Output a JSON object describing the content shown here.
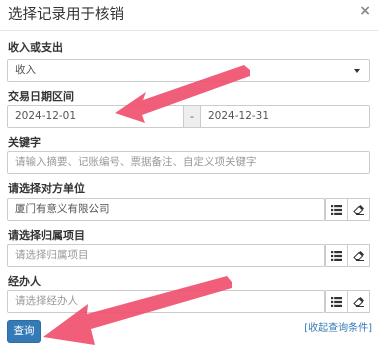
{
  "modal": {
    "title": "选择记录用于核销",
    "close_label": "×"
  },
  "direction": {
    "label": "收入或支出",
    "value": "收入"
  },
  "date_range": {
    "label": "交易日期区间",
    "start": "2024-12-01",
    "separator": "-",
    "end": "2024-12-31"
  },
  "keyword": {
    "label": "关键字",
    "placeholder": "请输入摘要、记账编号、票据备注、自定义项关键字"
  },
  "counterparty": {
    "label": "请选择对方单位",
    "value": "厦门有意义有限公司"
  },
  "project": {
    "label": "请选择归属项目",
    "placeholder": "请选择归属项目"
  },
  "handler": {
    "label": "经办人",
    "placeholder": "请选择经办人"
  },
  "actions": {
    "query_label": "查询",
    "collapse_label": "[收起查询条件]"
  },
  "colors": {
    "primary": "#337ab7",
    "annotation_arrow": "#f0506e"
  }
}
